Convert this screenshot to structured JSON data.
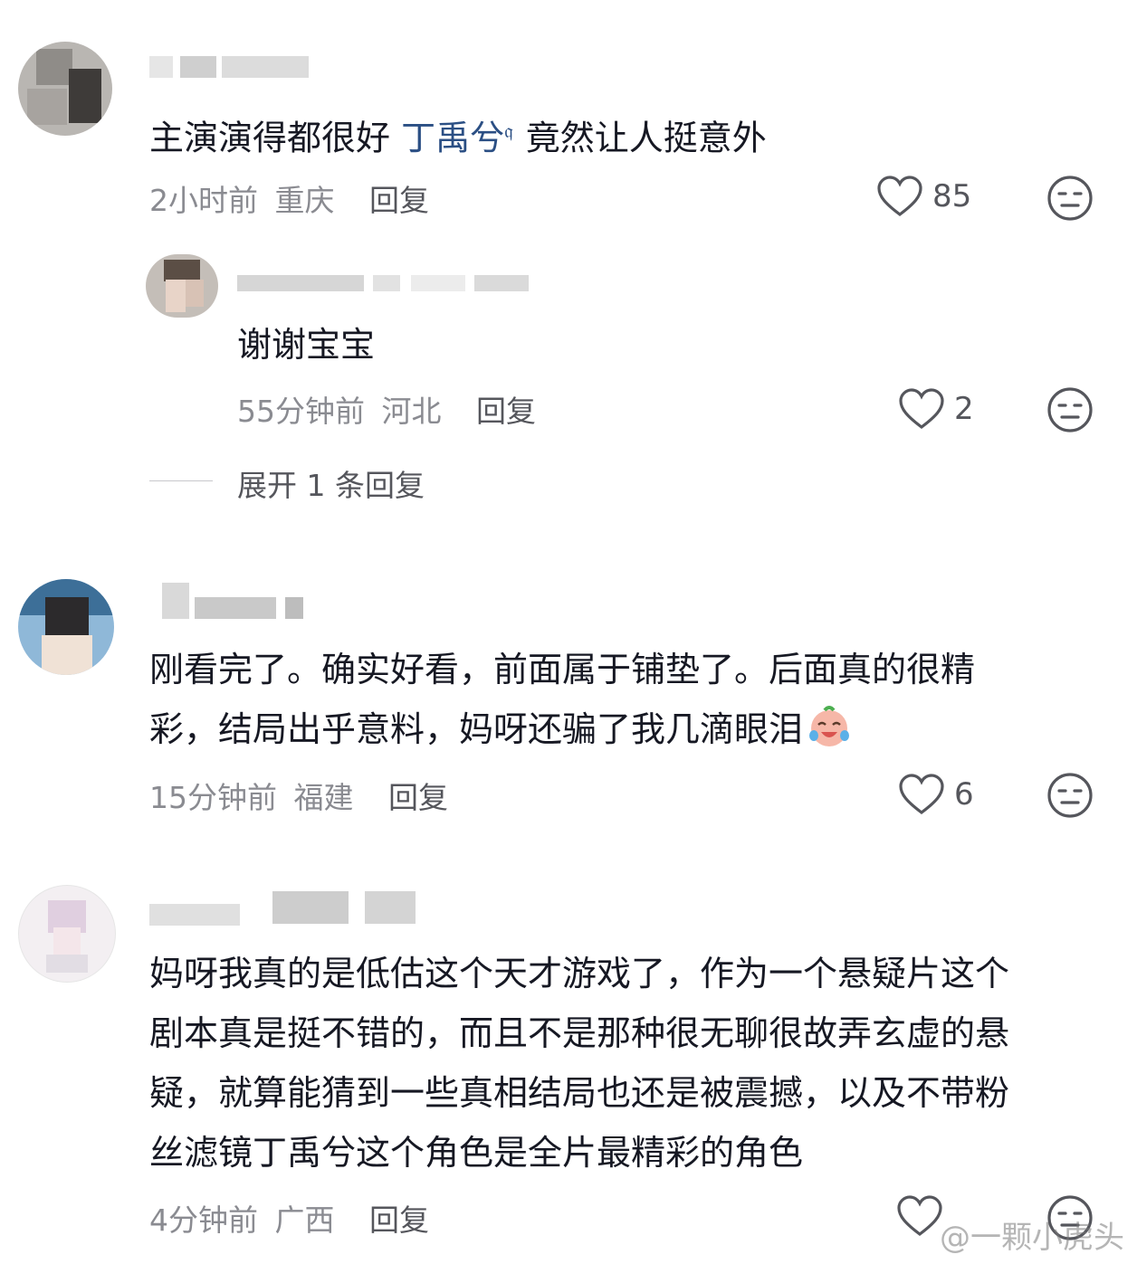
{
  "comments": [
    {
      "text_before": "主演演得都很好 ",
      "mention": "丁禹兮",
      "text_after": "竟然让人挺意外",
      "time": "2小时前",
      "location": "重庆",
      "reply_label": "回复",
      "likes": "85"
    },
    {
      "text": "谢谢宝宝",
      "time": "55分钟前",
      "location": "河北",
      "reply_label": "回复",
      "likes": "2"
    },
    {
      "expand_label": "展开 1 条回复"
    },
    {
      "line1": "刚看完了。确实好看，前面属于铺垫了。后面真的很精",
      "line2": "彩，结局出乎意料，妈呀还骗了我几滴眼泪",
      "time": "15分钟前",
      "location": "福建",
      "reply_label": "回复",
      "likes": "6"
    },
    {
      "line1": "妈呀我真的是低估这个天才游戏了，作为一个悬疑片这个",
      "line2": "剧本真是挺不错的，而且不是那种很无聊很故弄玄虚的悬",
      "line3": "疑，就算能猜到一些真相结局也还是被震撼，以及不带粉",
      "line4": "丝滤镜丁禹兮这个角色是全片最精彩的角色",
      "time": "4分钟前",
      "location": "广西",
      "reply_label": "回复"
    }
  ],
  "watermark": "@一颗小虎头",
  "icons": {
    "like": "heart-icon",
    "dislike": "meh-face-icon",
    "emoji": "crying-laughing-emoji",
    "search": "search-icon"
  },
  "colors": {
    "text": "#161823",
    "meta": "#8a8b91",
    "mention": "#2b4f84"
  }
}
